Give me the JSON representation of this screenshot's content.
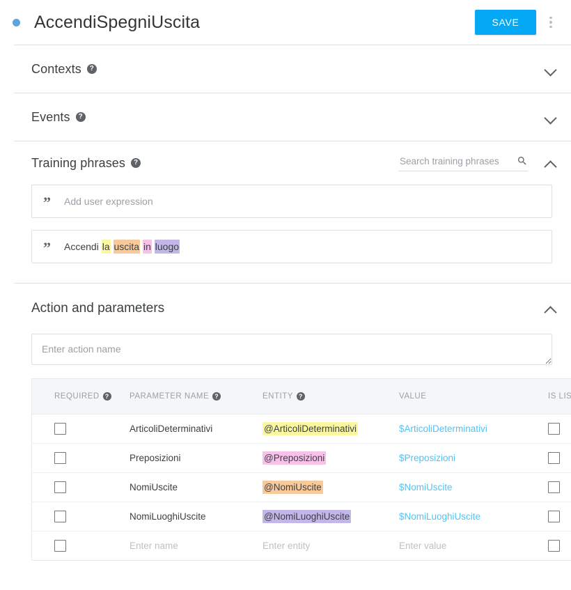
{
  "header": {
    "intent_title": "AccendiSpegniUscita",
    "save_label": "SAVE",
    "dot_color": "#5fa2dd",
    "save_color": "#03a9f4"
  },
  "sections": {
    "contexts": {
      "title": "Contexts",
      "help": "?",
      "collapsed": true
    },
    "events": {
      "title": "Events",
      "help": "?",
      "collapsed": true
    },
    "training_phrases": {
      "title": "Training phrases",
      "help": "?",
      "collapsed": false,
      "search_placeholder": "Search training phrases",
      "search_value": "",
      "add_placeholder": "Add user expression",
      "quote_glyph": "”",
      "phrase": {
        "tokens": [
          {
            "text": "Accendi ",
            "color": ""
          },
          {
            "text": "la",
            "color": "#fbf7a0"
          },
          {
            "text": " ",
            "color": ""
          },
          {
            "text": "uscita",
            "color": "#f9c99a"
          },
          {
            "text": " ",
            "color": ""
          },
          {
            "text": "in",
            "color": "#f9c0ea"
          },
          {
            "text": " ",
            "color": ""
          },
          {
            "text": "luogo",
            "color": "#c3b6e8"
          }
        ]
      }
    },
    "action_and_parameters": {
      "title": "Action and parameters",
      "collapsed": false,
      "action_placeholder": "Enter action name",
      "action_value": "",
      "table": {
        "columns": [
          {
            "label": "REQUIRED",
            "help": "?"
          },
          {
            "label": "PARAMETER NAME",
            "help": "?"
          },
          {
            "label": "ENTITY",
            "help": "?"
          },
          {
            "label": "VALUE",
            "help": ""
          },
          {
            "label": "IS LIST",
            "help": "?"
          }
        ],
        "rows": [
          {
            "required": false,
            "parameter_name": "ArticoliDeterminativi",
            "entity": "@ArticoliDeterminativi",
            "entity_color": "#fbf7a0",
            "value": "$ArticoliDeterminativi",
            "is_list": false
          },
          {
            "required": false,
            "parameter_name": "Preposizioni",
            "entity": "@Preposizioni",
            "entity_color": "#f9c0ea",
            "value": "$Preposizioni",
            "is_list": false
          },
          {
            "required": false,
            "parameter_name": "NomiUscite",
            "entity": "@NomiUscite",
            "entity_color": "#f9c99a",
            "value": "$NomiUscite",
            "is_list": false
          },
          {
            "required": false,
            "parameter_name": "NomiLuoghiUscite",
            "entity": "@NomiLuoghiUscite",
            "entity_color": "#c3b6e8",
            "value": "$NomiLuoghiUscite",
            "is_list": false
          }
        ],
        "new_row": {
          "name_placeholder": "Enter name",
          "entity_placeholder": "Enter entity",
          "value_placeholder": "Enter value"
        }
      }
    }
  },
  "icons": {
    "search": "search-icon",
    "kebab": "more-vert-icon",
    "chevron_down": "chevron-down-icon",
    "chevron_up": "chevron-up-icon"
  }
}
